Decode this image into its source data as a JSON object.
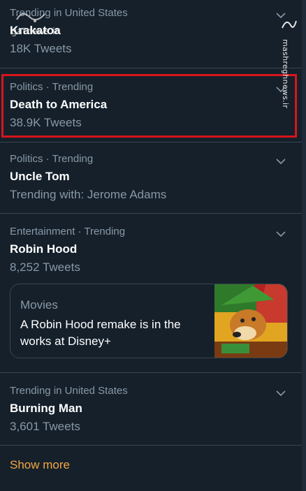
{
  "trends": [
    {
      "context": "Trending in United States",
      "name": "Krakatoa",
      "sub": "18K Tweets"
    },
    {
      "context": "Politics · Trending",
      "name": "Death to America",
      "sub": "38.9K Tweets"
    },
    {
      "context": "Politics · Trending",
      "name": "Uncle Tom",
      "sub": "Trending with: Jerome Adams"
    },
    {
      "context": "Entertainment · Trending",
      "name": "Robin Hood",
      "sub": "8,252 Tweets"
    },
    {
      "context": "Trending in United States",
      "name": "Burning Man",
      "sub": "3,601 Tweets"
    }
  ],
  "news_card": {
    "category": "Movies",
    "headline": "A Robin Hood remake is in the works at Disney+"
  },
  "show_more": "Show more",
  "watermarks": {
    "left_text": "gatnews.ir",
    "right_text": "mashreghnews.ir"
  },
  "colors": {
    "background": "#15202b",
    "secondary_text": "#8899a6",
    "highlight": "#d7151b",
    "link": "#f4a742"
  }
}
